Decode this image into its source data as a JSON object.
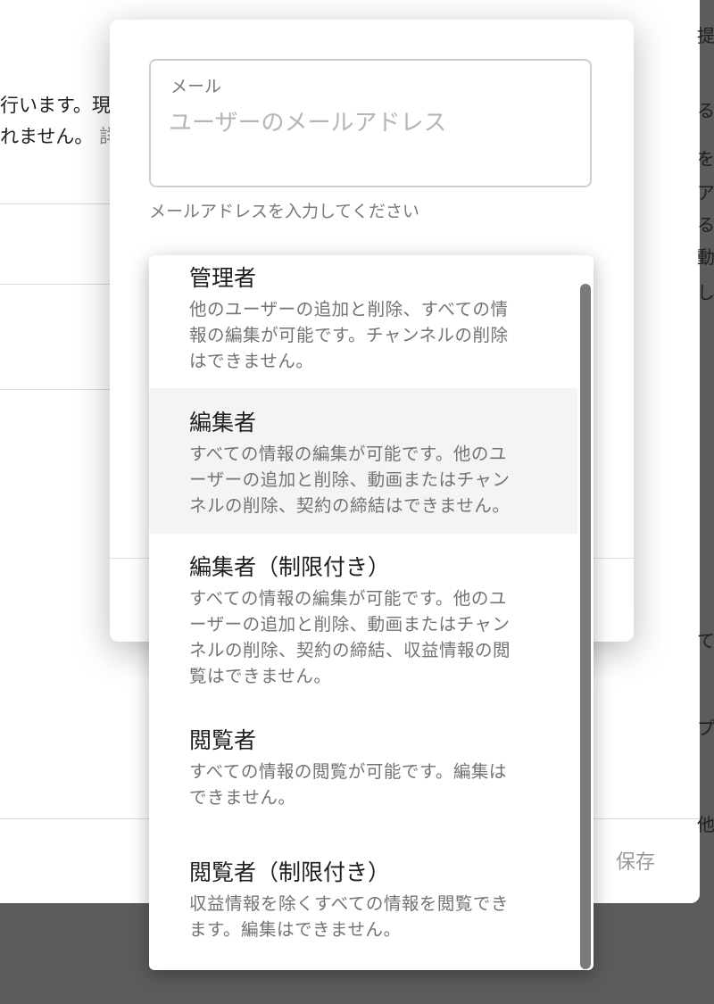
{
  "background": {
    "line1": "行います。現",
    "line2_text": "れません。",
    "line2_link": "詳",
    "right_col": [
      "提実",
      "る",
      "を",
      "ア",
      "る",
      "動",
      "し",
      "て",
      "プ",
      "他"
    ],
    "save_label": "保存"
  },
  "dialog": {
    "email": {
      "label": "メール",
      "placeholder": "ユーザーのメールアドレス",
      "value": "",
      "helper": "メールアドレスを入力してください"
    }
  },
  "roles": [
    {
      "title": "管理者",
      "lines": [
        "他のユーザーの追加と削除、すべての情",
        "報の編集が可能です。チャンネルの削除",
        "はできません。"
      ]
    },
    {
      "title": "編集者",
      "lines": [
        "すべての情報の編集が可能です。他のユ",
        "ーザーの追加と削除、動画またはチャン",
        "ネルの削除、契約の締結はできません。"
      ]
    },
    {
      "title": "編集者（制限付き）",
      "lines": [
        "すべての情報の編集が可能です。他のユ",
        "ーザーの追加と削除、動画またはチャン",
        "ネルの削除、契約の締結、収益情報の閲",
        "覧はできません。"
      ]
    },
    {
      "title": "閲覧者",
      "lines": [
        "すべての情報の閲覧が可能です。編集は",
        "できません。"
      ]
    },
    {
      "title": "閲覧者（制限付き）",
      "lines": [
        "収益情報を除くすべての情報を閲覧でき",
        "ます。編集はできません。"
      ]
    }
  ],
  "colors": {
    "overlay": "#5c5c5c",
    "highlight": "#f4f4f4",
    "scrollbar": "#7a7a7a"
  }
}
